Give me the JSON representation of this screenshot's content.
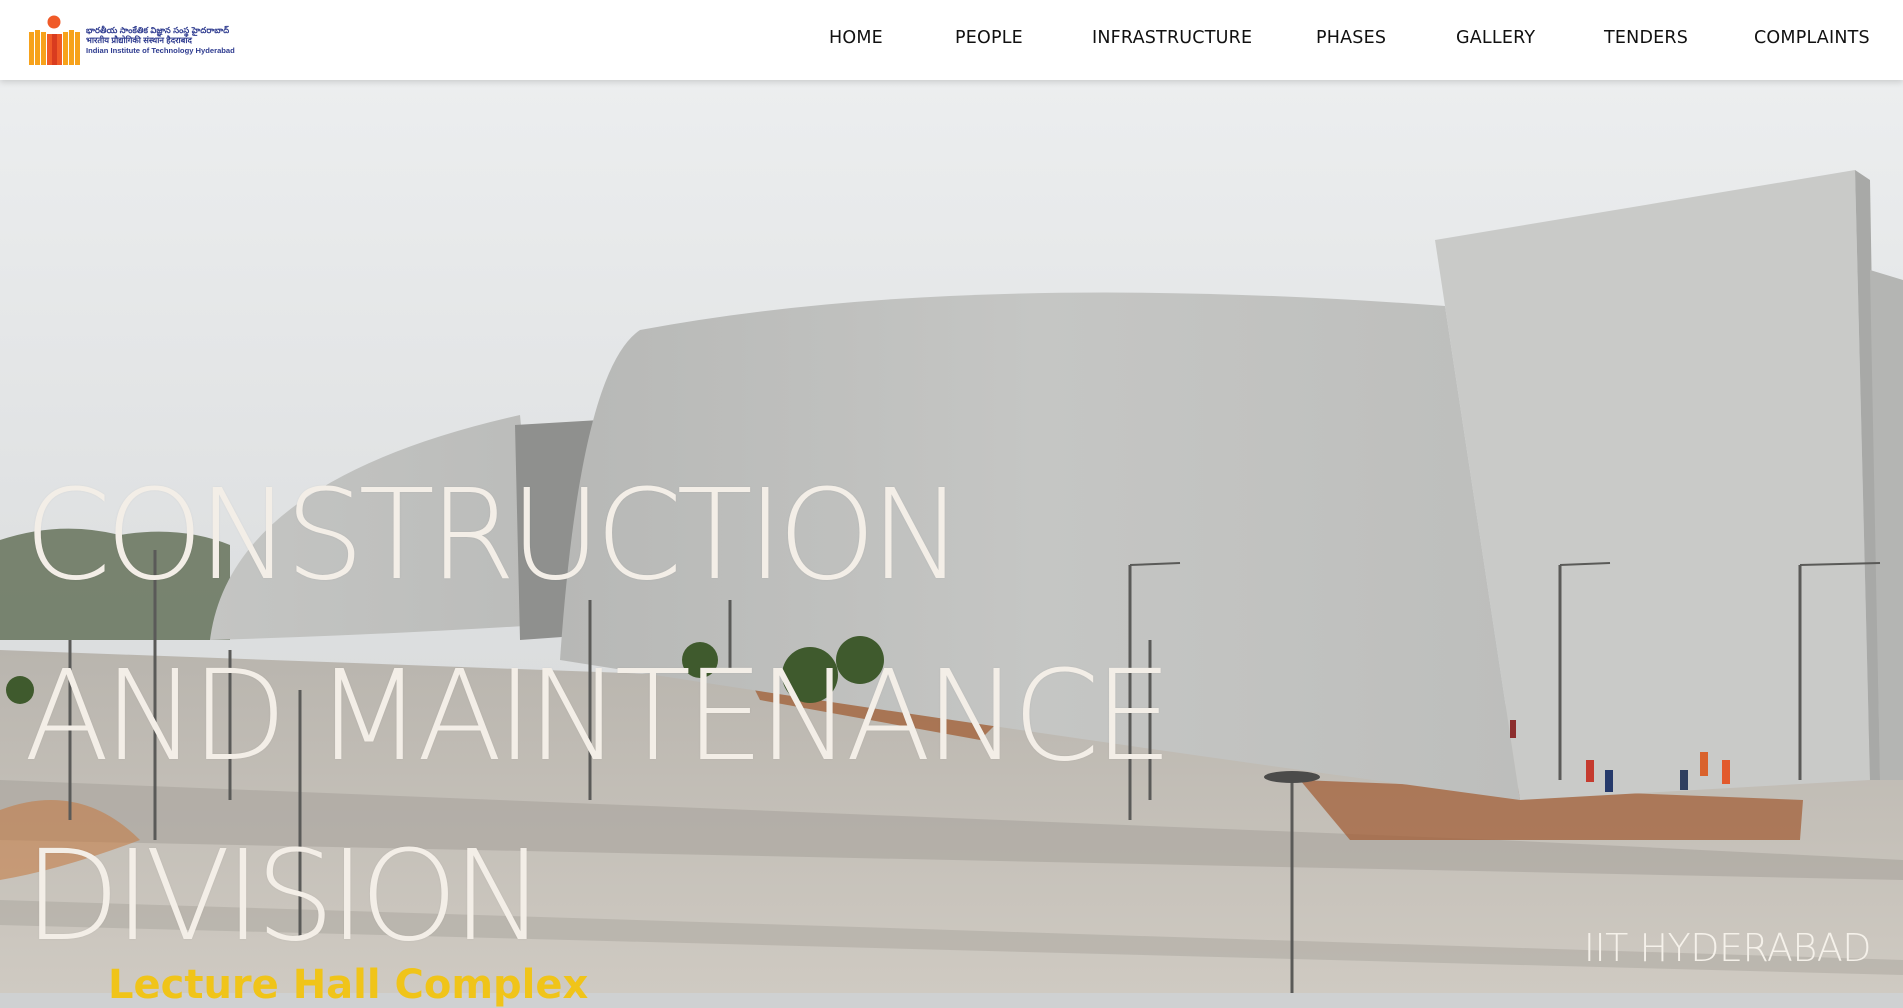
{
  "header": {
    "logo": {
      "line1": "భారతీయ సాంకేతిక విజ్ఞాన సంస్థ హైదరాబాద్",
      "line2": "भारतीय प्रौद्योगिकी संस्थान हैदराबाद",
      "line3": "Indian Institute of Technology Hyderabad",
      "icon": "iith-logo-icon",
      "colors": {
        "orange": "#f39c12",
        "red": "#e74c3c",
        "blue": "#2e3b8f"
      }
    },
    "nav": [
      {
        "label": "HOME"
      },
      {
        "label": "PEOPLE"
      },
      {
        "label": "INFRASTRUCTURE"
      },
      {
        "label": "PHASES"
      },
      {
        "label": "GALLERY"
      },
      {
        "label": "TENDERS"
      },
      {
        "label": "COMPLAINTS"
      }
    ]
  },
  "hero": {
    "headline_line1": "CONSTRUCTION",
    "headline_line2": "AND MAINTENANCE",
    "headline_line3": "DIVISION",
    "caption": "Lecture Hall Complex",
    "tagline": "IIT HYDERABAD",
    "colors": {
      "headline": "#f3eee7",
      "caption": "#f0c419",
      "sky": "#e6e7e8"
    }
  }
}
